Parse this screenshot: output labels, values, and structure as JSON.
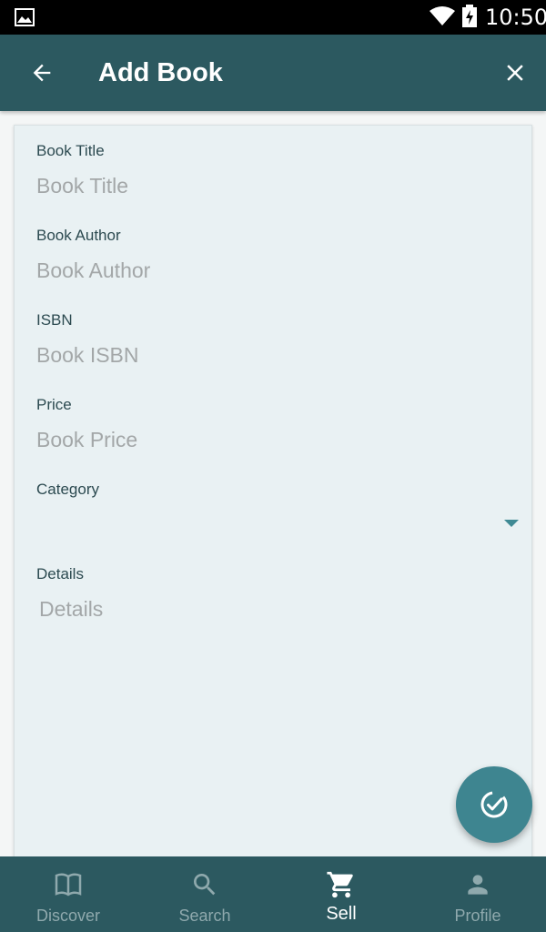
{
  "status_bar": {
    "time": "10:50"
  },
  "app_bar": {
    "title": "Add Book"
  },
  "form": {
    "title": {
      "label": "Book Title",
      "placeholder": "Book Title",
      "value": ""
    },
    "author": {
      "label": "Book Author",
      "placeholder": "Book Author",
      "value": ""
    },
    "isbn": {
      "label": "ISBN",
      "placeholder": "Book ISBN",
      "value": ""
    },
    "price": {
      "label": "Price",
      "placeholder": "Book Price",
      "value": ""
    },
    "category": {
      "label": "Category",
      "selected": ""
    },
    "details": {
      "label": "Details",
      "placeholder": "Details",
      "value": ""
    }
  },
  "fab": {
    "icon": "check-circle-icon"
  },
  "bottom_nav": {
    "items": [
      {
        "label": "Discover",
        "icon": "book-open-icon",
        "active": false
      },
      {
        "label": "Search",
        "icon": "search-icon",
        "active": false
      },
      {
        "label": "Sell",
        "icon": "cart-icon",
        "active": true
      },
      {
        "label": "Profile",
        "icon": "person-icon",
        "active": false
      }
    ]
  },
  "colors": {
    "app_bar": "#2c5960",
    "card_bg": "#e9f1f3",
    "fab": "#3e8590",
    "nav_inactive": "#8fa9ad",
    "nav_active": "#ffffff"
  }
}
